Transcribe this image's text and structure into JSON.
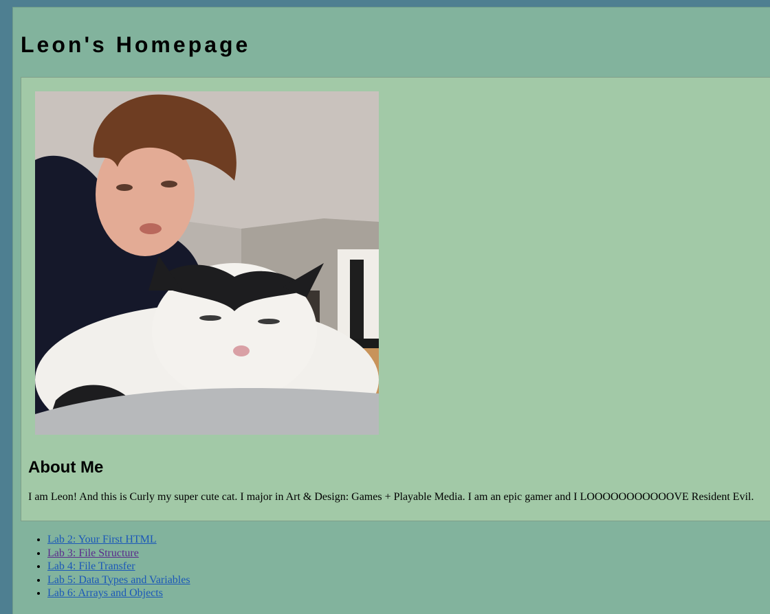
{
  "page": {
    "title": "Leon's Homepage"
  },
  "about": {
    "heading": "About Me",
    "text": "I am Leon! And this is Curly my super cute cat. I major in Art & Design: Games + Playable Media. I am an epic gamer and I LOOOOOOOOOOOVE Resident Evil."
  },
  "photo": {
    "subject": "selfie-with-cat"
  },
  "links": [
    {
      "label": "Lab 2: Your First HTML",
      "visited": false
    },
    {
      "label": "Lab 3: File Structure",
      "visited": true
    },
    {
      "label": "Lab 4: File Transfer",
      "visited": false
    },
    {
      "label": "Lab 5: Data Types and Variables",
      "visited": false
    },
    {
      "label": "Lab 6: Arrays and Objects",
      "visited": false
    }
  ],
  "colors": {
    "outer_background": "#4e7f91",
    "page_background": "#82b39d",
    "content_background": "#a2c9a7",
    "link": "#1a57b8",
    "link_visited": "#5a2b8c"
  }
}
